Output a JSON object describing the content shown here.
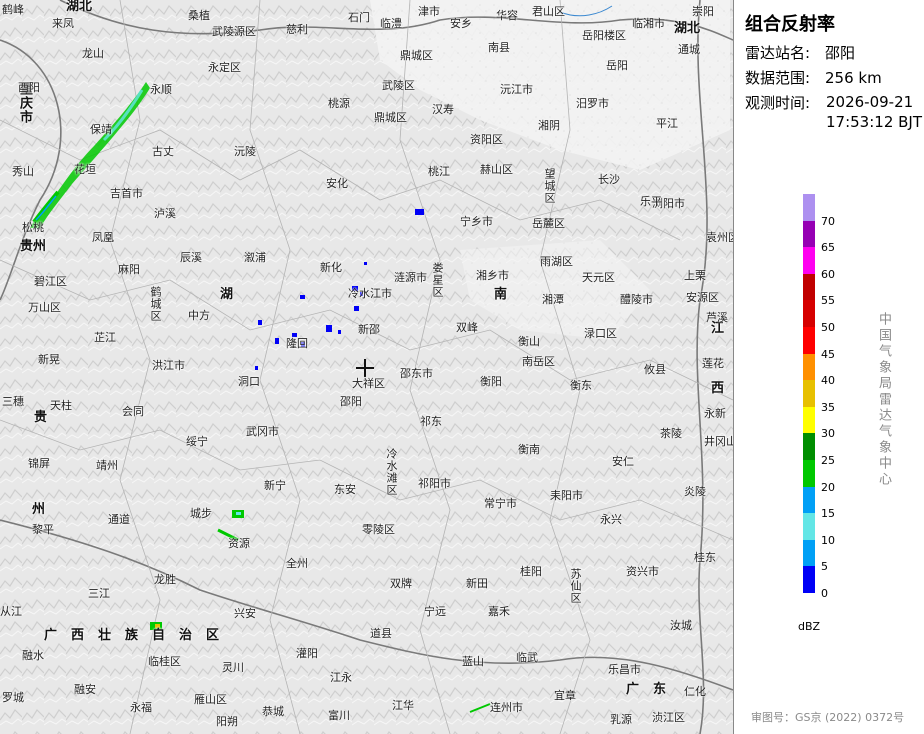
{
  "panel": {
    "title": "组合反射率",
    "station_label": "雷达站名:",
    "station_value": "邵阳",
    "range_label": "数据范围:",
    "range_value": "256 km",
    "time_label": "观测时间:",
    "time_date": "2026-09-21",
    "time_clock": "17:53:12 BJT",
    "unit": "dBZ",
    "source": "中国气象局雷达气象中心",
    "approval": "审图号：GS京 (2022) 0372号"
  },
  "legend": {
    "labels": [
      "70",
      "65",
      "60",
      "55",
      "50",
      "45",
      "40",
      "35",
      "30",
      "25",
      "20",
      "15",
      "10",
      "5",
      "0"
    ],
    "colors": [
      "#ad90f0",
      "#9600b4",
      "#ff00f0",
      "#c00000",
      "#d60000",
      "#ff0000",
      "#ff9000",
      "#e7c000",
      "#ffff00",
      "#008e00",
      "#00c800",
      "#01a0f6",
      "#63e6e6",
      "#00a0f6",
      "#0000f6"
    ]
  },
  "map": {
    "radar_marker": "radar-site-crosshair",
    "provinces": [
      {
        "name": "湖北",
        "key": "hubei-nw"
      },
      {
        "name": "湖北",
        "key": "hubei-ne"
      },
      {
        "name": "重庆市",
        "key": "chongqing"
      },
      {
        "name": "贵州",
        "key": "guizhou-1"
      },
      {
        "name": "贵",
        "key": "guizhou-2"
      },
      {
        "name": "州",
        "key": "guizhou-3"
      },
      {
        "name": "湖",
        "key": "hunan-1"
      },
      {
        "name": "南",
        "key": "hunan-2"
      },
      {
        "name": "江",
        "key": "jiangxi-1"
      },
      {
        "name": "西",
        "key": "jiangxi-2"
      },
      {
        "name": "广西壮族自治区",
        "key": "guangxi"
      },
      {
        "name": "广东",
        "key": "guangdong"
      }
    ],
    "places": [
      "鹤峰",
      "桑植",
      "慈利",
      "石门",
      "临澧",
      "津市",
      "安乡",
      "华容",
      "君山区",
      "崇阳",
      "来凤",
      "武陵源区",
      "永定区",
      "鼎城区",
      "南县",
      "岳阳楼区",
      "临湘市",
      "通城",
      "龙山",
      "永顺",
      "武陵区",
      "汉寿",
      "沅江市",
      "岳阳",
      "酉阳",
      "桃源",
      "鼎城区",
      "汨罗市",
      "保靖",
      "古丈",
      "沅陵",
      "资阳区",
      "赫山区",
      "湘阴",
      "平江",
      "秀山",
      "花垣",
      "吉首市",
      "安化",
      "桃江",
      "望城区",
      "长沙",
      "泸溪",
      "宁乡市",
      "岳麓区",
      "浏阳市",
      "松桃",
      "凤凰",
      "溆浦",
      "新化",
      "涟源市",
      "娄星区",
      "湘乡市",
      "雨湖区",
      "天元区",
      "碧江区",
      "麻阳",
      "辰溪",
      "冷水江市",
      "湘潭",
      "醴陵市",
      "上栗",
      "万山区",
      "鹤城区",
      "中方",
      "新邵",
      "双峰",
      "衡山",
      "渌口区",
      "安源区",
      "芷江",
      "隆回",
      "南岳区",
      "攸县",
      "莲花",
      "新晃",
      "洪江市",
      "邵东市",
      "衡阳",
      "衡东",
      "洞口",
      "大祥区",
      "邵阳",
      "三穗",
      "天柱",
      "会同",
      "武冈市",
      "祁东",
      "衡南",
      "安仁",
      "茶陵",
      "锦屏",
      "靖州",
      "绥宁",
      "冷水滩区",
      "祁阳市",
      "永新",
      "新宁",
      "东安",
      "常宁市",
      "耒阳市",
      "炎陵",
      "黎平",
      "通道",
      "城步",
      "资源",
      "零陵区",
      "永兴",
      "井冈山市",
      "全州",
      "双牌",
      "新田",
      "桂阳",
      "资兴市",
      "桂东",
      "三江",
      "龙胜",
      "兴安",
      "宁远",
      "嘉禾",
      "苏仙区",
      "汝城",
      "融水",
      "临桂区",
      "灵川",
      "灌阳",
      "道县",
      "蓝山",
      "临武",
      "融安",
      "乐昌市",
      "仁化",
      "罗城",
      "永福",
      "雁山区",
      "江永",
      "宜章",
      "阳朔",
      "恭城",
      "富川",
      "江华",
      "连州市",
      "乳源",
      "浈江区",
      "从江",
      "芦溪",
      "袁州区",
      "乐平"
    ]
  }
}
